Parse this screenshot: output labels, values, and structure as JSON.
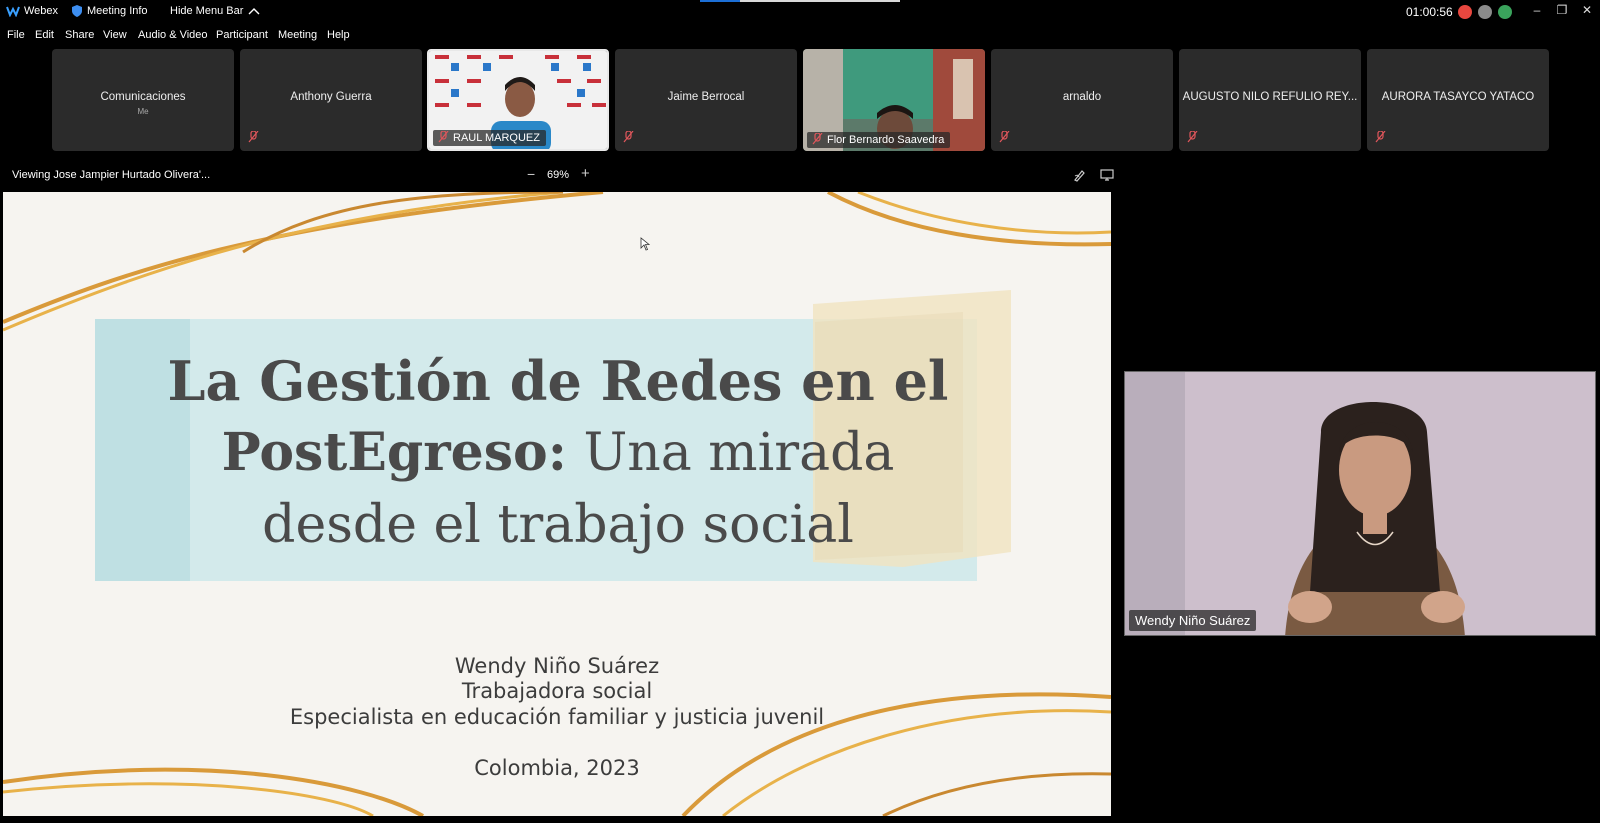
{
  "titlebar": {
    "app_name": "Webex",
    "meeting_info": "Meeting Info",
    "hide_menu_bar": "Hide Menu Bar",
    "timer": "01:00:56",
    "colors": {
      "record": "#e8473f",
      "status_gray": "#8a8a8a",
      "status_green": "#3aa35c"
    }
  },
  "menu": [
    "File",
    "Edit",
    "Share",
    "View",
    "Audio & Video",
    "Participant",
    "Meeting",
    "Help"
  ],
  "participants": [
    {
      "name": "Comunicaciones",
      "sub": "Me",
      "video": false,
      "muted": false
    },
    {
      "name": "Anthony Guerra",
      "video": false,
      "muted": true
    },
    {
      "name": "RAUL MARQUEZ",
      "video": true,
      "muted": true,
      "active": true
    },
    {
      "name": "Jaime Berrocal",
      "video": false,
      "muted": true
    },
    {
      "name": "Flor Bernardo Saavedra",
      "video": true,
      "muted": true
    },
    {
      "name": "arnaldo",
      "video": false,
      "muted": true
    },
    {
      "name": "AUGUSTO NILO REFULIO REY...",
      "video": false,
      "muted": true
    },
    {
      "name": "AURORA TASAYCO YATACO",
      "video": false,
      "muted": true
    }
  ],
  "share": {
    "viewing": "Viewing Jose Jampier Hurtado Olivera'...",
    "zoom": "69%",
    "zoom_out": "−",
    "zoom_in": "+"
  },
  "slide": {
    "title_line1": "La Gestión de Redes en el",
    "title_line2_bold": "PostEgreso:",
    "title_line2_rest": " Una mirada",
    "title_line3": "desde el trabajo social",
    "author": "Wendy Niño Suárez",
    "role": "Trabajadora social",
    "specialty": "Especialista en educación familiar y justicia juvenil",
    "place_year": "Colombia, 2023",
    "accent_gold": "#d9a23a",
    "wash_blue": "#cfe9ea"
  },
  "speaker": {
    "name": "Wendy Niño Suárez"
  }
}
